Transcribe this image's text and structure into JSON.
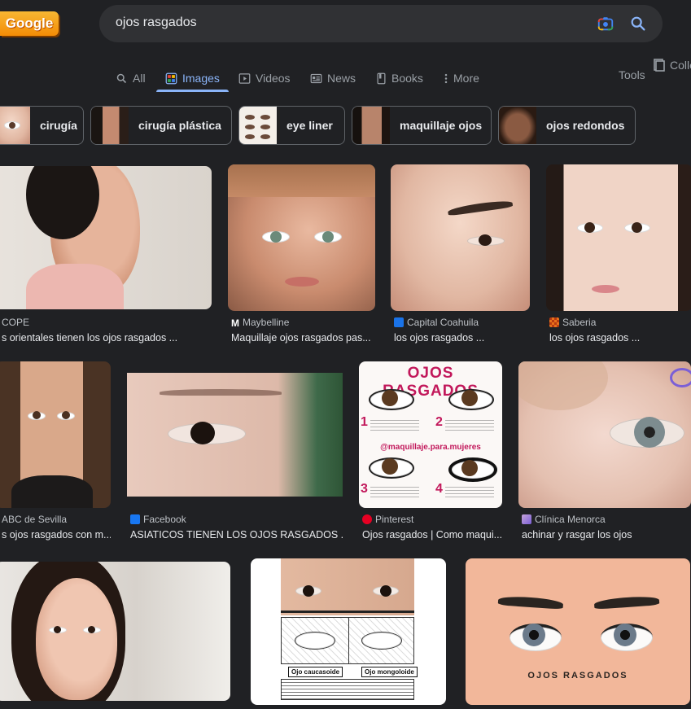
{
  "logo": {
    "text": "Google"
  },
  "search": {
    "query": "ojos rasgados"
  },
  "tabs": [
    {
      "label": "All"
    },
    {
      "label": "Images"
    },
    {
      "label": "Videos"
    },
    {
      "label": "News"
    },
    {
      "label": "Books"
    },
    {
      "label": "More"
    }
  ],
  "tools_label": "Tools",
  "collections_label": "Colle",
  "chips": [
    {
      "label": "cirugía"
    },
    {
      "label": "cirugía plástica"
    },
    {
      "label": "eye liner"
    },
    {
      "label": "maquillaje ojos"
    },
    {
      "label": "ojos redondos"
    }
  ],
  "results": [
    {
      "source": "COPE",
      "caption": "s orientales tienen los ojos rasgados ..."
    },
    {
      "source": "Maybelline",
      "caption": "Maquillaje ojos rasgados pas..."
    },
    {
      "source": "Capital Coahuila",
      "caption": "los ojos rasgados ..."
    },
    {
      "source": "Saberia",
      "caption": "los ojos rasgados ..."
    },
    {
      "source": "ABC de Sevilla",
      "caption": "s ojos rasgados con m..."
    },
    {
      "source": "Facebook",
      "caption": "ASIATICOS TIENEN LOS OJOS RASGADOS ..."
    },
    {
      "source": "Pinterest",
      "caption": "Ojos rasgados | Como maqui..."
    },
    {
      "source": "Clínica Menorca",
      "caption": "achinar y rasgar los ojos"
    }
  ],
  "infographic": {
    "title": "OJOS RASGADOS",
    "handle": "@maquillaje.para.mujeres",
    "steps": [
      "1",
      "2",
      "3",
      "4"
    ]
  },
  "diagram": {
    "label_left": "Ojo caucasoide",
    "label_right": "Ojo mongoloide"
  },
  "illustration": {
    "title": "OJOS RASGADOS"
  },
  "colors": {
    "background": "#202124",
    "accent": "#8ab4f8",
    "chip_border": "#5f6368"
  }
}
